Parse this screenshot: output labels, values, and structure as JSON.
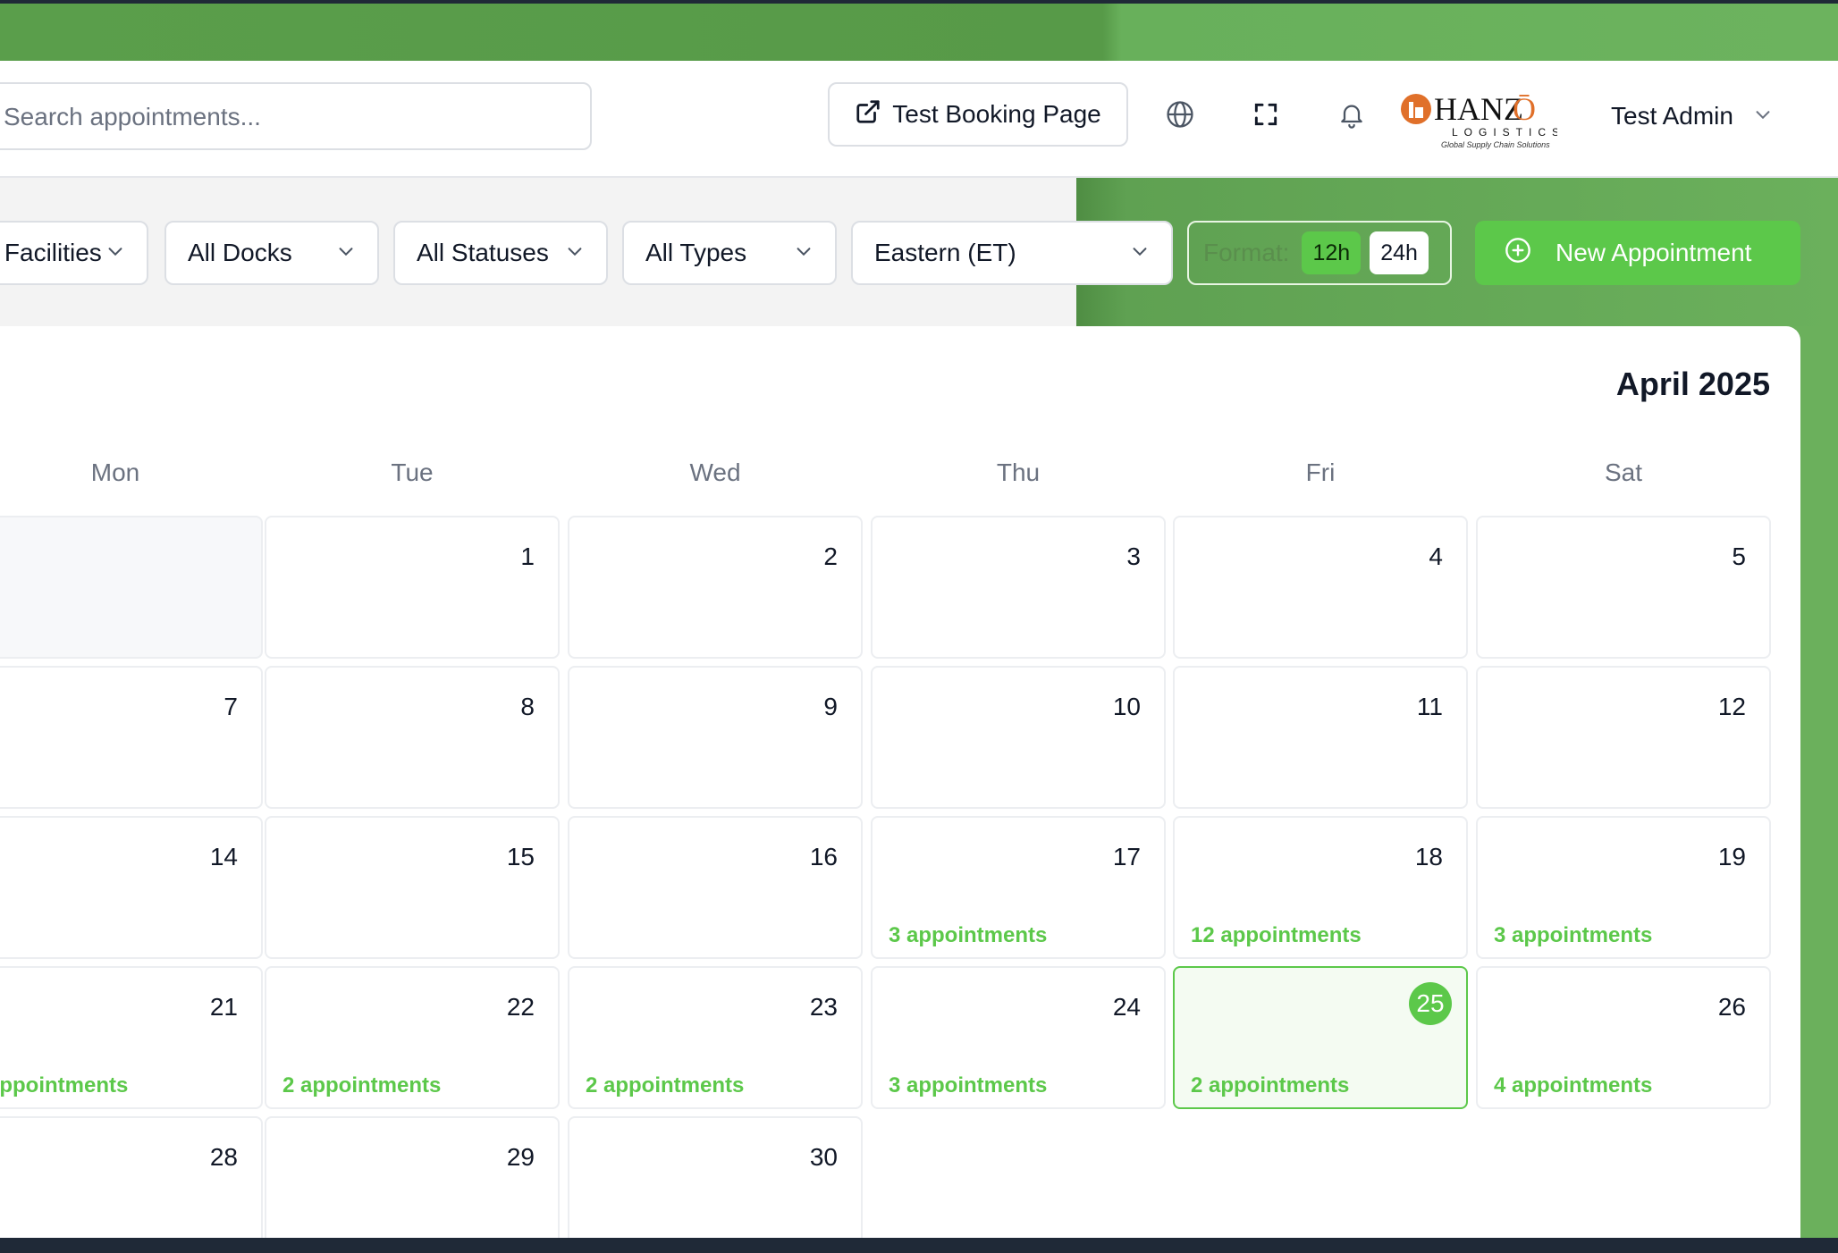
{
  "header": {
    "search_placeholder": "Search appointments...",
    "booking_button": "Test Booking Page",
    "logo": {
      "brand": "HANZŌ",
      "sub": "LOGISTICS",
      "tagline": "Global Supply Chain Solutions"
    },
    "user_name": "Test Admin"
  },
  "filters": {
    "facilities": "All Facilities",
    "docks": "All Docks",
    "statuses": "All Statuses",
    "types": "All Types",
    "timezone": "Eastern (ET)",
    "format_label": "Format:",
    "format_12h": "12h",
    "format_24h": "24h",
    "new_appointment": "New Appointment"
  },
  "colors": {
    "accent": "#5cc84a",
    "topbar": "#5a9e4b"
  },
  "calendar": {
    "month": "April 2025",
    "weekdays": [
      "Mon",
      "Tue",
      "Wed",
      "Thu",
      "Fri",
      "Sat"
    ],
    "weeks": [
      [
        {
          "day": "",
          "appts": ""
        },
        {
          "day": "1",
          "appts": ""
        },
        {
          "day": "2",
          "appts": ""
        },
        {
          "day": "3",
          "appts": ""
        },
        {
          "day": "4",
          "appts": ""
        },
        {
          "day": "5",
          "appts": ""
        }
      ],
      [
        {
          "day": "7",
          "appts": ""
        },
        {
          "day": "8",
          "appts": ""
        },
        {
          "day": "9",
          "appts": ""
        },
        {
          "day": "10",
          "appts": ""
        },
        {
          "day": "11",
          "appts": ""
        },
        {
          "day": "12",
          "appts": ""
        }
      ],
      [
        {
          "day": "14",
          "appts": ""
        },
        {
          "day": "15",
          "appts": ""
        },
        {
          "day": "16",
          "appts": ""
        },
        {
          "day": "17",
          "appts": "3 appointments"
        },
        {
          "day": "18",
          "appts": "12 appointments"
        },
        {
          "day": "19",
          "appts": "3 appointments"
        }
      ],
      [
        {
          "day": "21",
          "appts": "appointments"
        },
        {
          "day": "22",
          "appts": "2 appointments"
        },
        {
          "day": "23",
          "appts": "2 appointments"
        },
        {
          "day": "24",
          "appts": "3 appointments"
        },
        {
          "day": "25",
          "appts": "2 appointments",
          "today": true
        },
        {
          "day": "26",
          "appts": "4 appointments"
        }
      ],
      [
        {
          "day": "28",
          "appts": ""
        },
        {
          "day": "29",
          "appts": ""
        },
        {
          "day": "30",
          "appts": ""
        }
      ]
    ]
  }
}
